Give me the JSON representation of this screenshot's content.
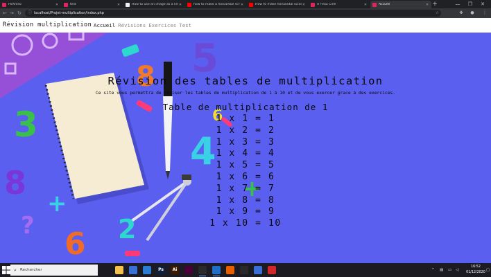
{
  "browser": {
    "tabs": [
      {
        "title": "Portfolio",
        "favicon_color": "#e0245e",
        "active": false
      },
      {
        "title": "test",
        "favicon_color": "#e0245e",
        "active": false
      },
      {
        "title": "How to use an image as a link in...",
        "favicon_color": "#f0f0f0",
        "active": false
      },
      {
        "title": "how to make a horizontal scroll in...",
        "favicon_color": "#ff0000",
        "active": false
      },
      {
        "title": "How to make horizontal scroll in...",
        "favicon_color": "#ff0000",
        "active": false
      },
      {
        "title": "A l'eau Ciné",
        "favicon_color": "#e0245e",
        "active": false
      },
      {
        "title": "Accueil",
        "favicon_color": "#e0245e",
        "active": true
      }
    ],
    "url": "localhost/Projet-multiplication/index.php"
  },
  "site": {
    "brand": "Révision multiplication",
    "nav": [
      {
        "label": "Accueil",
        "current": true
      },
      {
        "label": "Révisions",
        "current": false
      },
      {
        "label": "Exercices",
        "current": false
      },
      {
        "label": "Test",
        "current": false
      }
    ],
    "title": "Révision des tables de multiplication",
    "intro": "Ce site vous permettra de réviser les tables de multiplication de 1 à 10 et de vous exercer grace à des exercices.",
    "table_title": "Table de multiplication de 1",
    "table_rows": [
      "1 x 1 = 1",
      "1 x 2 = 2",
      "1 x 3 = 3",
      "1 x 4 = 4",
      "1 x 5 = 5",
      "1 x 6 = 6",
      "1 x 7 = 7",
      "1 x 8 = 8",
      "1 x 9 = 9",
      "1 x 10 = 10"
    ]
  },
  "taskbar": {
    "search_placeholder": "Rechercher",
    "time": "16:52",
    "date": "01/12/2020",
    "apps": [
      {
        "name": "task-view",
        "label": "",
        "color": "#1c1b22",
        "running": false
      },
      {
        "name": "file-explorer",
        "label": "",
        "color": "#f2c14e",
        "running": false
      },
      {
        "name": "microsoft-store",
        "label": "",
        "color": "#3a6fd8",
        "running": false
      },
      {
        "name": "mail",
        "label": "",
        "color": "#2b7cd3",
        "running": false
      },
      {
        "name": "photoshop",
        "label": "Ps",
        "color": "#0d1f3a",
        "running": false
      },
      {
        "name": "illustrator",
        "label": "Ai",
        "color": "#3a1a00",
        "running": false
      },
      {
        "name": "xd",
        "label": "",
        "color": "#470137",
        "running": false
      },
      {
        "name": "chrome",
        "label": "",
        "color": "#2a2a2a",
        "running": true
      },
      {
        "name": "vscode",
        "label": "",
        "color": "#1f6fc5",
        "running": true
      },
      {
        "name": "firefox",
        "label": "",
        "color": "#e66000",
        "running": false
      },
      {
        "name": "media-player",
        "label": "",
        "color": "#2a2a2a",
        "running": false
      },
      {
        "name": "photos",
        "label": "",
        "color": "#3a6fd8",
        "running": false
      },
      {
        "name": "app-red",
        "label": "",
        "color": "#d02828",
        "running": false
      }
    ]
  }
}
